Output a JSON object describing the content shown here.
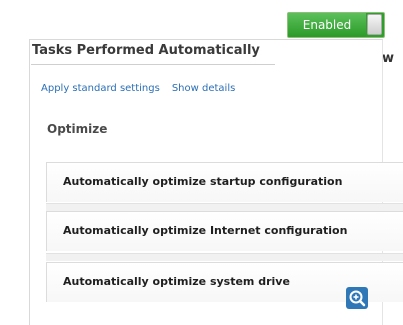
{
  "cutoff": {
    "text": "w"
  },
  "panel": {
    "title": "Tasks Performed Automatically"
  },
  "toggle": {
    "label": "Enabled"
  },
  "links": {
    "apply": "Apply standard settings",
    "details": "Show details"
  },
  "optimize": {
    "heading": "Optimize",
    "items": [
      {
        "label": "Automatically optimize startup configuration"
      },
      {
        "label": "Automatically optimize Internet configuration"
      },
      {
        "label": "Automatically optimize system drive"
      }
    ]
  },
  "zoom": {
    "icon": "zoom-in-icon"
  }
}
